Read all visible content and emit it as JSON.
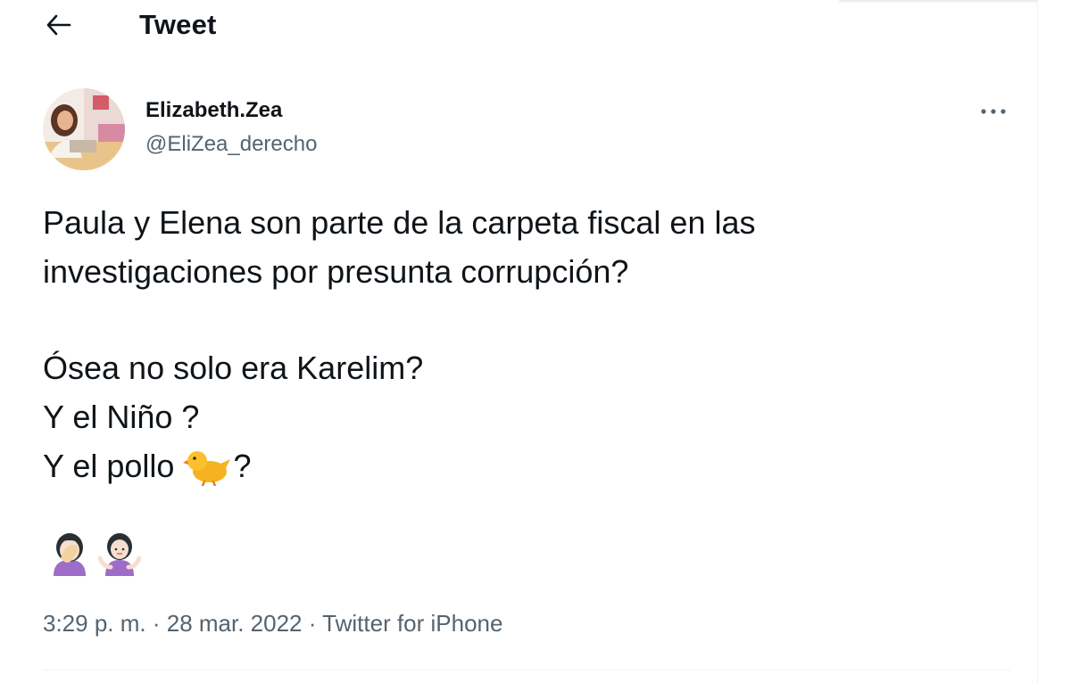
{
  "header": {
    "title": "Tweet"
  },
  "icons": {
    "back": "arrow-left-icon",
    "more": "more-horizontal-icon",
    "chick": "baby-chick-emoji",
    "facepalm": "woman-facepalming-emoji",
    "shrug": "woman-shrugging-emoji"
  },
  "author": {
    "name": "Elizabeth.Zea",
    "handle": "@EliZea_derecho"
  },
  "tweet": {
    "line1": "Paula y Elena son parte de la carpeta fiscal en las",
    "line2": "investigaciones por presunta corrupción?",
    "line3": "Ósea no solo era Karelim?",
    "line4": "Y el Niño ?",
    "line5_before": "Y el pollo",
    "line5_after": "?"
  },
  "meta": {
    "time": "3:29 p. m.",
    "sep1": " · ",
    "date": "28 mar. 2022",
    "sep2": " · ",
    "source": "Twitter for iPhone"
  },
  "colors": {
    "text": "#0f1419",
    "secondary": "#536471",
    "divider": "#eff3f4"
  }
}
